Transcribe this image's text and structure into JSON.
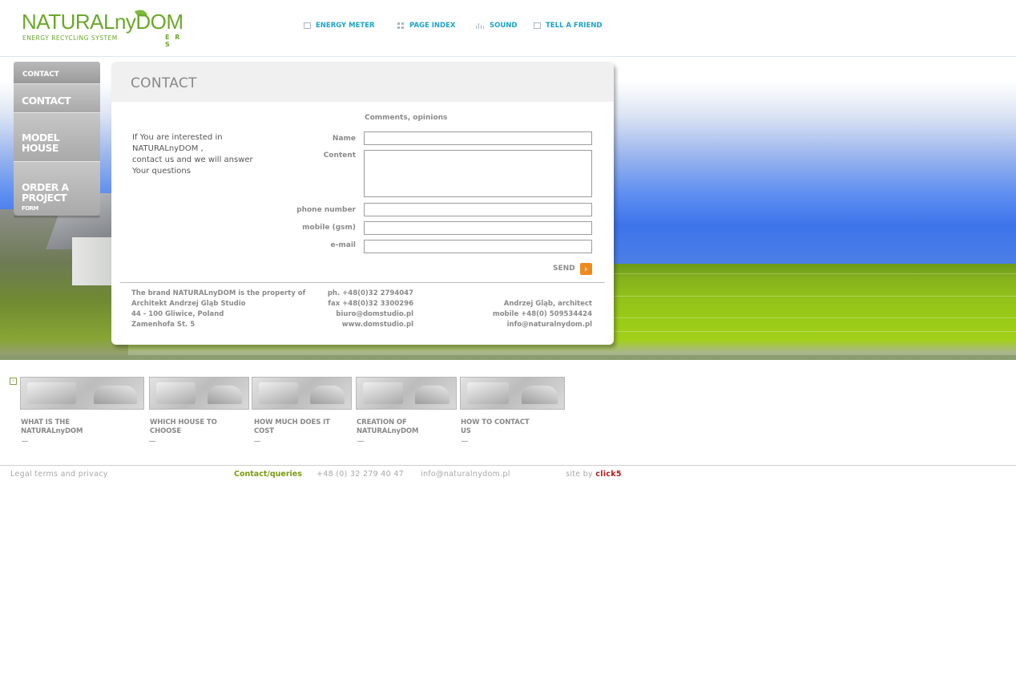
{
  "header": {
    "logo": {
      "main_left": "NATURAL",
      "main_mid": "ny",
      "main_right": "DOM",
      "subtitle": "ENERGY RECYCLING SYSTEM",
      "suffix": "E R S"
    },
    "nav": [
      {
        "label": "ENERGY METER",
        "icon": "energy-meter-icon"
      },
      {
        "label": "PAGE INDEX",
        "icon": "page-index-icon"
      },
      {
        "label": "SOUND",
        "icon": "sound-icon"
      },
      {
        "label": "TELL A FRIEND",
        "icon": "tell-a-friend-icon"
      }
    ]
  },
  "sidemenu": {
    "header": "CONTACT",
    "items": [
      {
        "label": "CONTACT"
      },
      {
        "label": "MODEL\nHOUSE"
      },
      {
        "label": "ORDER A\nPROJECT",
        "sub": "FORM"
      }
    ]
  },
  "contact": {
    "title": "CONTACT",
    "intro": "If You are interested in\nNATURALnyDOM ,\ncontact us and we will answer\nYour questions",
    "form": {
      "caption": "Comments, opinions",
      "name_label": "Name",
      "content_label": "Content",
      "phone_label": "phone number",
      "mobile_label": "mobile (gsm)",
      "email_label": "e-mail",
      "name_value": "",
      "content_value": "",
      "phone_value": "",
      "mobile_value": "",
      "email_value": "",
      "send_label": "SEND"
    },
    "footer": {
      "brand_text": "The brand NATURALnyDOM is the property of\nArchitekt Andrzej Gląb Studio\n44 - 100 Gliwice, Poland\nZamenhofa St. 5",
      "office_text": "ph. +48(0)32 2794047\nfax +48(0)32 3300296\nbiuro@domstudio.pl\nwww.domstudio.pl",
      "architect_text": "Andrzej Gląb, architect\nmobile +48(0) 509534424\ninfo@naturalnydom.pl"
    }
  },
  "thumbs": [
    {
      "label": "WHAT IS THE\nNATURALnyDOM"
    },
    {
      "label": "WHICH HOUSE TO\nCHOOSE"
    },
    {
      "label": "HOW MUCH DOES IT\nCOST"
    },
    {
      "label": "CREATION OF\nNATURALnyDOM"
    },
    {
      "label": "HOW TO CONTACT\nUS"
    }
  ],
  "page_footer": {
    "legal": "Legal terms and privacy",
    "contact_label": "Contact/queries",
    "phone": "+48 (0) 32 279 40 47",
    "email": "info@naturalnydom.pl",
    "siteby_label": "site by",
    "siteby_brand": "click5"
  },
  "colors": {
    "accent_green": "#6aa82a",
    "nav_blue": "#1fa2c9",
    "send_orange": "#f08a1e",
    "click5_red": "#b11c1c"
  }
}
